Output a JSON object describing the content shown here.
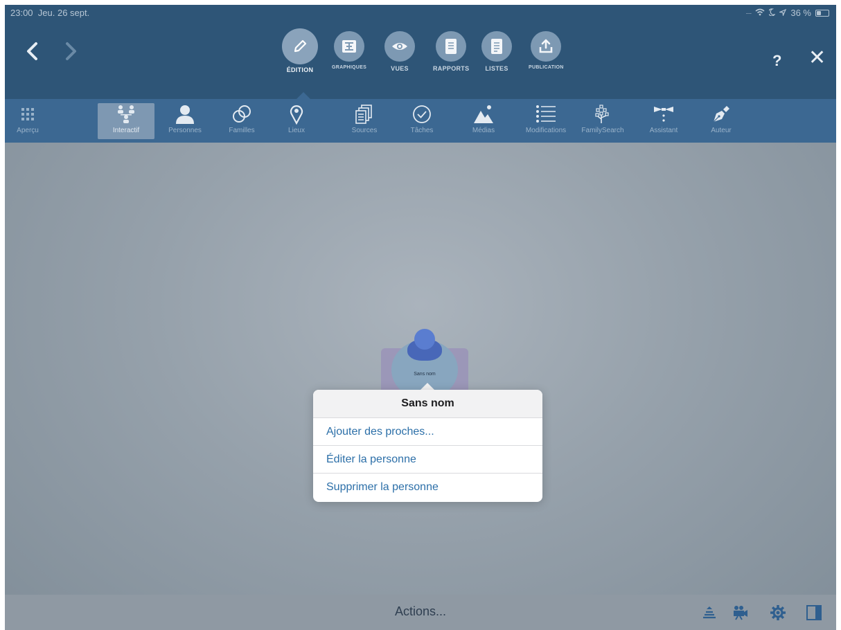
{
  "status": {
    "time": "23:00",
    "date": "Jeu. 26 sept.",
    "battery": "36 %",
    "battery_level": 0.36
  },
  "nav": {
    "back_icon": "chevron-left-icon",
    "forward_icon": "chevron-right-icon",
    "help": "?",
    "close": "✕"
  },
  "modes": [
    {
      "label": "ÉDITION",
      "icon": "pencil-icon"
    },
    {
      "label": "GRAPHIQUES",
      "icon": "tree-chart-icon"
    },
    {
      "label": "VUES",
      "icon": "eye-icon"
    },
    {
      "label": "RAPPORTS",
      "icon": "report-icon"
    },
    {
      "label": "LISTES",
      "icon": "list-document-icon"
    },
    {
      "label": "PUBLICATION",
      "icon": "upload-icon"
    }
  ],
  "tools": [
    {
      "label": "Aperçu",
      "icon": "grid-icon"
    },
    {
      "label": "Interactif",
      "icon": "family-tree-icon"
    },
    {
      "label": "Personnes",
      "icon": "person-icon"
    },
    {
      "label": "Familles",
      "icon": "rings-icon"
    },
    {
      "label": "Lieux",
      "icon": "map-pin-icon"
    },
    {
      "label": "Sources",
      "icon": "documents-icon"
    },
    {
      "label": "Tâches",
      "icon": "check-circle-icon"
    },
    {
      "label": "Médias",
      "icon": "landscape-icon"
    },
    {
      "label": "Modifications",
      "icon": "list-icon"
    },
    {
      "label": "FamilySearch",
      "icon": "familysearch-tree-icon"
    },
    {
      "label": "Assistant",
      "icon": "bowtie-icon"
    },
    {
      "label": "Auteur",
      "icon": "fountain-pen-icon"
    }
  ],
  "node": {
    "name": "Sans nom"
  },
  "popover": {
    "title": "Sans nom",
    "items": [
      "Ajouter des proches...",
      "Éditer la personne",
      "Supprimer la personne"
    ]
  },
  "bottom": {
    "actions": "Actions..."
  },
  "colors": {
    "topbar": "#2e5577",
    "subbar": "#3c6892",
    "link": "#2c6fa8",
    "canvas": "#96a1ab"
  }
}
